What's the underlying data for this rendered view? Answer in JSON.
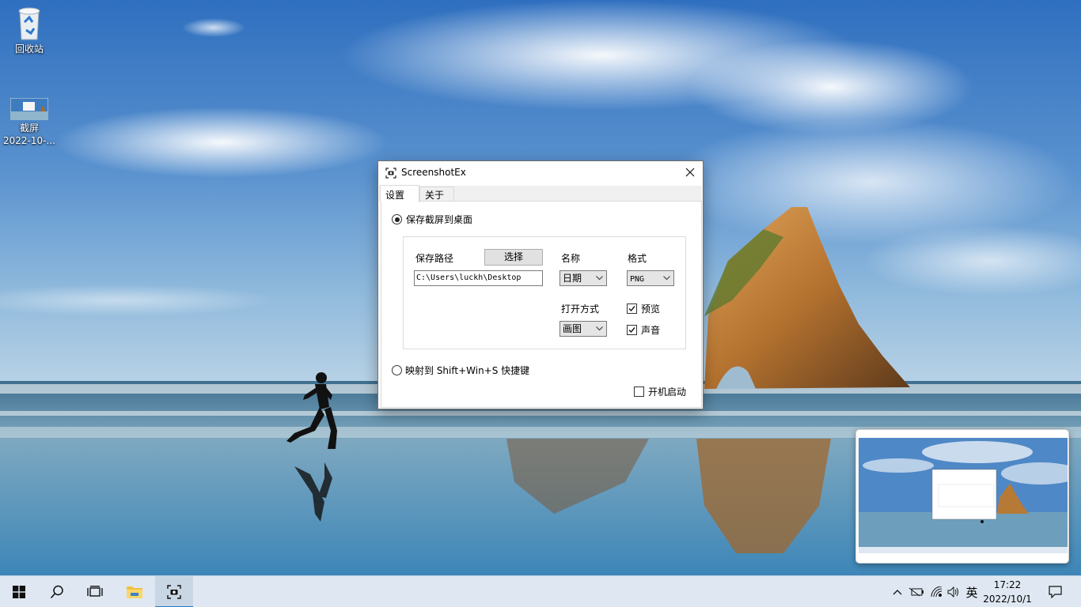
{
  "desktop": {
    "icons": [
      {
        "label": "回收站"
      },
      {
        "label": "截屏",
        "sublabel": "2022-10-..."
      }
    ]
  },
  "dialog": {
    "title": "ScreenshotEx",
    "tabs": [
      {
        "label": "设置",
        "selected": true
      },
      {
        "label": "关于",
        "selected": false
      }
    ],
    "save_to_desktop": {
      "label": "保存截屏到桌面",
      "checked": true
    },
    "path": {
      "label": "保存路径",
      "choose_button": "选择",
      "value": "C:\\Users\\luckh\\Desktop"
    },
    "name": {
      "label": "名称",
      "value": "日期"
    },
    "format": {
      "label": "格式",
      "value": "PNG"
    },
    "open_with": {
      "label": "打开方式",
      "value": "画图"
    },
    "preview": {
      "label": "预览",
      "checked": true
    },
    "sound": {
      "label": "声音",
      "checked": true
    },
    "map_shortcut": {
      "label": "映射到 Shift+Win+S 快捷键",
      "checked": false
    },
    "autostart": {
      "label": "开机启动",
      "checked": false
    }
  },
  "taskbar": {
    "apps": [
      {
        "name": "start",
        "icon": "windows-logo-icon"
      },
      {
        "name": "search",
        "icon": "search-icon"
      },
      {
        "name": "task-view",
        "icon": "task-view-icon"
      },
      {
        "name": "file-explorer",
        "icon": "folder-icon"
      },
      {
        "name": "screenshotex",
        "icon": "camera-icon",
        "active": true
      }
    ],
    "tray": {
      "ime": "英",
      "time": "17:22",
      "date": "2022/10/1"
    }
  },
  "colors": {
    "taskbar_bg": "#dfe8f2",
    "accent": "#2b78d0",
    "button_face": "#e1e1e1"
  }
}
